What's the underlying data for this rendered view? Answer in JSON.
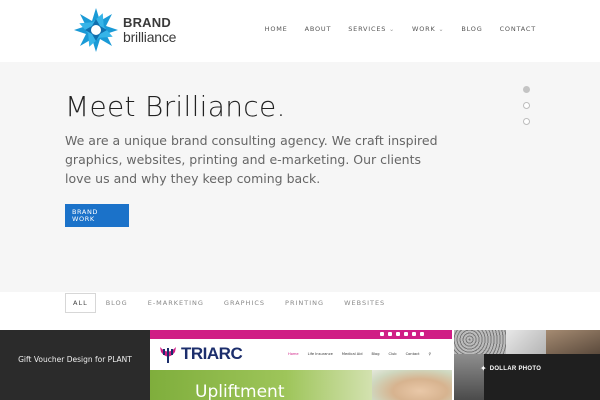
{
  "brand": {
    "line1": "BRAND",
    "line2": "brilliance",
    "accent": "#1a9ad6"
  },
  "nav": {
    "items": [
      {
        "label": "HOME",
        "dropdown": false
      },
      {
        "label": "ABOUT",
        "dropdown": false
      },
      {
        "label": "SERVICES",
        "dropdown": true
      },
      {
        "label": "WORK",
        "dropdown": true
      },
      {
        "label": "BLOG",
        "dropdown": false
      },
      {
        "label": "CONTACT",
        "dropdown": false
      }
    ],
    "dropdown_icon": "chevron-down-icon"
  },
  "hero": {
    "title": "Meet Brilliance.",
    "description": "We are a unique brand consulting agency. We craft inspired graphics, websites, printing and e-marketing. Our clients love us and why they keep coming back.",
    "button_line1": "BRAND",
    "button_line2": "WORK",
    "button_color": "#1b72c9",
    "slides_total": 3,
    "active_slide": 1
  },
  "filters": {
    "items": [
      "ALL",
      "BLOG",
      "E-MARKETING",
      "GRAPHICS",
      "PRINTING",
      "WEBSITES"
    ],
    "active": "ALL"
  },
  "portfolio": {
    "tile1": {
      "title": "Gift Voucher Design for PLANT"
    },
    "tile2": {
      "logo_text": "TRIARC",
      "menu": [
        "Home",
        "Life Insurance",
        "Medical Aid",
        "Blog",
        "Club",
        "Contact"
      ],
      "banner_text": "Upliftment",
      "accent": "#d01e85"
    },
    "tile3": {
      "logo_text": "DOLLAR PHOTO"
    }
  }
}
